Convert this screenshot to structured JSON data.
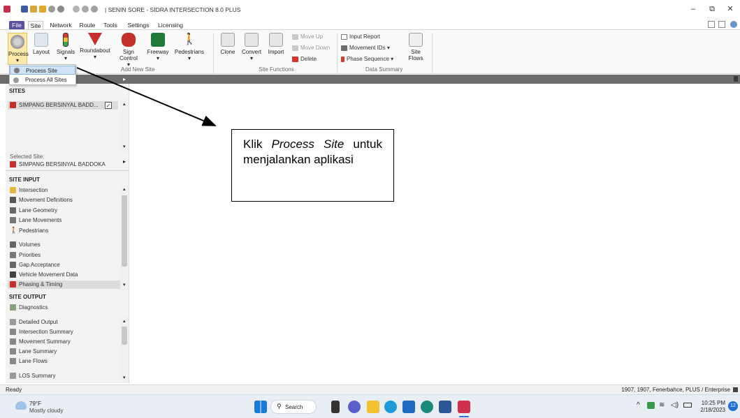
{
  "window": {
    "title": "| SENIN SORE - SIDRA INTERSECTION 8.0 PLUS",
    "controls": {
      "minimize": "–",
      "maximize": "⧉",
      "close": "✕"
    }
  },
  "ribbon_tabs": [
    "File",
    "Site",
    "Network",
    "Route",
    "Tools",
    "Settings",
    "Licensing"
  ],
  "ribbon": {
    "add_new_site": {
      "label": "Add New Site",
      "buttons": [
        "Process",
        "Layout",
        "Signals",
        "Roundabout",
        "Sign Control",
        "Freeway",
        "Pedestrians"
      ]
    },
    "site_functions": {
      "label": "Site Functions",
      "buttons": [
        "Clone",
        "Convert",
        "Import"
      ],
      "small_buttons": [
        "Move Up",
        "Move Down",
        "Delete"
      ]
    },
    "data_summary": {
      "label": "Data Summary",
      "small_buttons": [
        "Input Report",
        "Movement IDs",
        "Phase Sequence"
      ],
      "site_flows": "Site Flows"
    }
  },
  "process_menu": {
    "items": [
      "Process Site",
      "Process All Sites"
    ]
  },
  "sites_panel": {
    "header": "SITES",
    "site_item": "SIMPANG BERSINYAL BADD...",
    "selected_label": "Selected Site:",
    "selected_site": "SIMPANG BERSINYAL BADDOKA"
  },
  "site_input": {
    "header": "SITE INPUT",
    "items": [
      "Intersection",
      "Movement Definitions",
      "Lane Geometry",
      "Lane Movements",
      "Pedestrians",
      "Volumes",
      "Priorities",
      "Gap Acceptance",
      "Vehicle Movement Data",
      "Phasing & Timing"
    ]
  },
  "site_output": {
    "header": "SITE OUTPUT",
    "items": [
      "Diagnostics",
      "Detailed Output",
      "Intersection Summary",
      "Movement Summary",
      "Lane Summary",
      "Lane Flows",
      "LOS Summary"
    ]
  },
  "callout": {
    "prefix": "Klik",
    "emphasis": "Process Site",
    "suffix": "untuk menjalankan aplikasi"
  },
  "status": {
    "left": "Ready",
    "right": "1907, 1907, Fenerbahce, PLUS / Enterprise"
  },
  "taskbar": {
    "weather_temp": "79°F",
    "weather_desc": "Mostly cloudy",
    "search": "Search",
    "time": "10:25 PM",
    "date": "2/18/2023",
    "notifications": "12"
  },
  "colors": {
    "file_tab": "#5b4fa0",
    "dark_bar": "#6d6d6d",
    "selection": "#cfe3f7",
    "signal_icon": "#c5302c"
  }
}
